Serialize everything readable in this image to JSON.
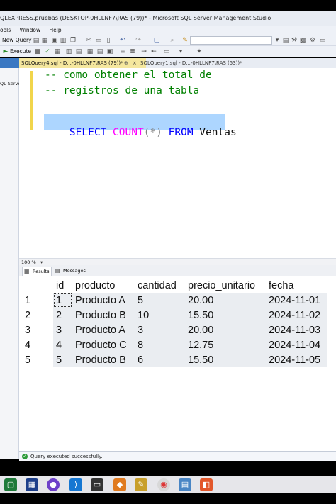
{
  "window": {
    "title": "QLEXPRESS.pruebas (DESKTOP-0HLLNF7\\RAS (79))* - Microsoft SQL Server Management Studio"
  },
  "menu": [
    "ools",
    "Window",
    "Help"
  ],
  "toolbar": {
    "new_query": "New Query",
    "execute": "Execute"
  },
  "left_panel": {
    "label": "QL Serve"
  },
  "tabs": [
    {
      "label": "SQLQuery4.sql - D...-0HLLNF7\\RAS (79))*",
      "pin": "⊕",
      "close": "×",
      "active": true
    },
    {
      "label": "SQLQuery1.sql - D...-0HLLNF7\\RAS (53))*",
      "active": false
    }
  ],
  "editor": {
    "comment1": "-- como obtener el total de",
    "comment2": "-- registros de una tabla",
    "sql": {
      "kw1": "SELECT",
      "fn": "COUNT",
      "lp": "(",
      "star": "*",
      "rp": ")",
      "kw2": "FROM",
      "table": "Ventas"
    }
  },
  "zoom": "100 %",
  "results_tabs": {
    "results": "Results",
    "messages": "Messages"
  },
  "grid": {
    "columns": [
      "id",
      "producto",
      "cantidad",
      "precio_unitario",
      "fecha"
    ],
    "rows": [
      {
        "n": "1",
        "cells": [
          "1",
          "Producto A",
          "5",
          "20.00",
          "2024-11-01"
        ]
      },
      {
        "n": "2",
        "cells": [
          "2",
          "Producto B",
          "10",
          "15.50",
          "2024-11-02"
        ]
      },
      {
        "n": "3",
        "cells": [
          "3",
          "Producto A",
          "3",
          "20.00",
          "2024-11-03"
        ]
      },
      {
        "n": "4",
        "cells": [
          "4",
          "Producto C",
          "8",
          "12.75",
          "2024-11-04"
        ]
      },
      {
        "n": "5",
        "cells": [
          "5",
          "Producto B",
          "6",
          "15.50",
          "2024-11-05"
        ]
      }
    ]
  },
  "status": {
    "message": "Query executed successfully."
  },
  "colors": {
    "comment": "#008000",
    "keyword": "#0000ff",
    "function": "#ff00ff",
    "operator": "#808080",
    "selection": "#add6ff",
    "taskbar": "#e6e6ea"
  },
  "taskbar_icons": [
    "start-icon",
    "vmware-icon",
    "github-icon",
    "vscode-icon",
    "terminal-icon",
    "sublime-icon",
    "ssms-icon",
    "chrome-icon",
    "notepad-icon",
    "orange-app-icon"
  ]
}
